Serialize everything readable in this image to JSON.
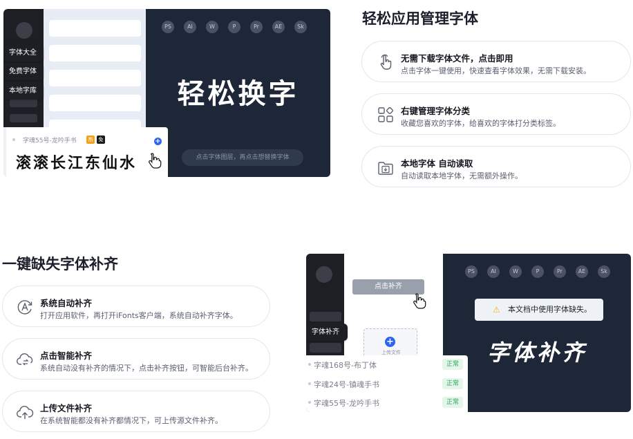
{
  "colors": {
    "dark_panel": "#1e2737",
    "sidebar": "#1d1f25",
    "accent_blue": "#2e63f2",
    "status_green": "#2ea35a",
    "warning": "#f5b700"
  },
  "panel_a": {
    "sidebar_labels": [
      "字体大全",
      "免费字体",
      "本地字库"
    ],
    "app_icons": [
      "PS",
      "AI",
      "W",
      "P",
      "Pr",
      "AE",
      "Sk"
    ],
    "preview_text": "轻松换字",
    "hint_text": "点击字体图层，再点击想替换字体",
    "font_card": {
      "name": "字魂55号-龙吟手书",
      "tag_orange": "热",
      "tag_black": "免",
      "sample": "滚滚长江东仙水"
    }
  },
  "section1": {
    "title": "轻松应用管理字体",
    "features": [
      {
        "icon": "tap-hand-icon",
        "title": "无需下载字体文件，点击即用",
        "desc": "点击字体一键使用，快速查看字体效果，无需下载安装。"
      },
      {
        "icon": "category-grid-icon",
        "title": "右键管理字体分类",
        "desc": "收藏您喜欢的字体，给喜欢的字体打分类标签。"
      },
      {
        "icon": "folder-download-icon",
        "title": "本地字体 自动读取",
        "desc": "自动读取本地字体，无需额外操作。"
      }
    ]
  },
  "section2": {
    "title": "一键缺失字体补齐",
    "features": [
      {
        "icon": "auto-text-icon",
        "title": "系统自动补齐",
        "desc": "打开应用软件，再打开iFonts客户端，系统自动补齐字体。"
      },
      {
        "icon": "smart-cloud-icon",
        "title": "点击智能补齐",
        "desc": "系统自动没有补齐的情况下，点击补齐按钮，可智能后台补齐。"
      },
      {
        "icon": "cloud-upload-icon",
        "title": "上传文件补齐",
        "desc": "在系统智能都没有补齐都情况下，可上传源文件补齐。"
      }
    ]
  },
  "panel_b": {
    "app_icons": [
      "PS",
      "AI",
      "W",
      "P",
      "Pr",
      "AE",
      "Sk"
    ],
    "sidebar_label": "字体补齐",
    "fill_button": "点击补齐",
    "upload_label": "上传文件",
    "alert_text": "本文档中使用字体缺失。",
    "preview_text": "字体补齐",
    "font_rows": [
      {
        "name": "字魂168号-布丁体",
        "status": "正常"
      },
      {
        "name": "字魂24号-镇魂手书",
        "status": "正常"
      },
      {
        "name": "字魂55号-龙吟手书",
        "status": "正常"
      }
    ]
  }
}
